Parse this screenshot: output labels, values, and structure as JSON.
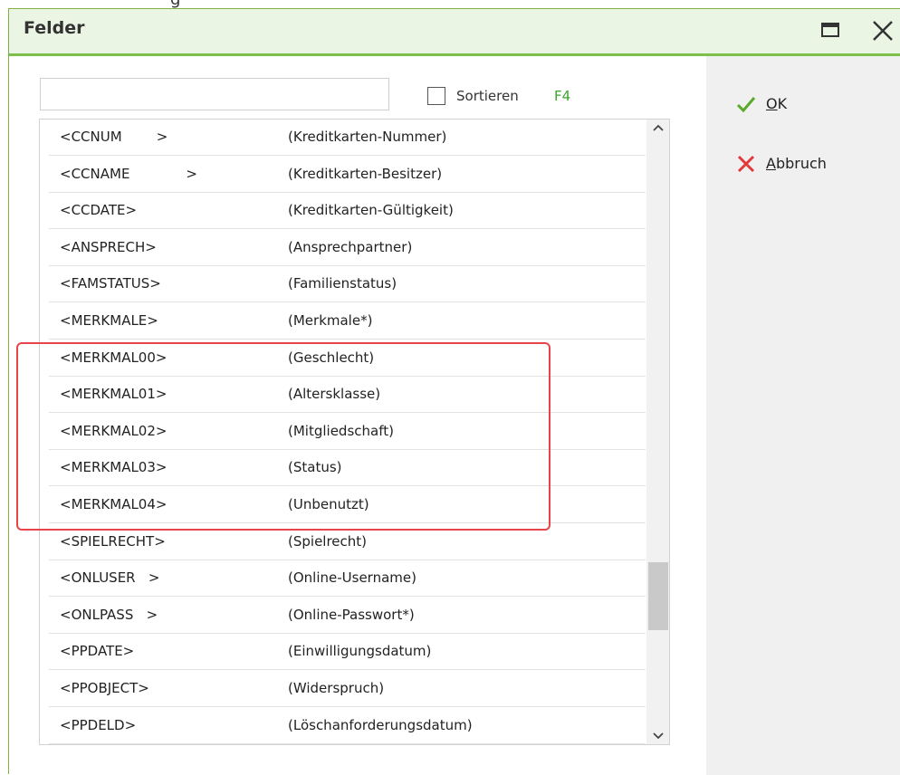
{
  "window": {
    "title": "Felder"
  },
  "search": {
    "value": "",
    "placeholder": ""
  },
  "sort": {
    "label": "Sortieren",
    "shortcut": "F4",
    "checked": false
  },
  "list": {
    "rows": [
      {
        "code": "<CCNUM        >",
        "desc": "(Kreditkarten-Nummer)"
      },
      {
        "code": "<CCNAME             >",
        "desc": "(Kreditkarten-Besitzer)"
      },
      {
        "code": "<CCDATE>",
        "desc": "(Kreditkarten-Gültigkeit)"
      },
      {
        "code": "<ANSPRECH>",
        "desc": "(Ansprechpartner)"
      },
      {
        "code": "<FAMSTATUS>",
        "desc": "(Familienstatus)"
      },
      {
        "code": "<MERKMALE>",
        "desc": "(Merkmale*)"
      },
      {
        "code": "<MERKMAL00>",
        "desc": "(Geschlecht)"
      },
      {
        "code": "<MERKMAL01>",
        "desc": "(Altersklasse)"
      },
      {
        "code": "<MERKMAL02>",
        "desc": "(Mitgliedschaft)"
      },
      {
        "code": "<MERKMAL03>",
        "desc": "(Status)"
      },
      {
        "code": "<MERKMAL04>",
        "desc": "(Unbenutzt)"
      },
      {
        "code": "<SPIELRECHT>",
        "desc": "(Spielrecht)"
      },
      {
        "code": "<ONLUSER   >",
        "desc": "(Online-Username)"
      },
      {
        "code": "<ONLPASS   >",
        "desc": "(Online-Passwort*)"
      },
      {
        "code": "<PPDATE>",
        "desc": "(Einwilligungsdatum)"
      },
      {
        "code": "<PPOBJECT>",
        "desc": "(Widerspruch)"
      },
      {
        "code": "<PPDELD>",
        "desc": "(Löschanforderungsdatum)"
      }
    ]
  },
  "actions": {
    "ok_label": "OK",
    "cancel_label": "Abbruch"
  },
  "colors": {
    "accent": "#7cc04b",
    "shortcut": "#3aa62c",
    "ok_icon": "#5aaa2a",
    "cancel_icon": "#e23a3a",
    "highlight": "#e8454a"
  }
}
